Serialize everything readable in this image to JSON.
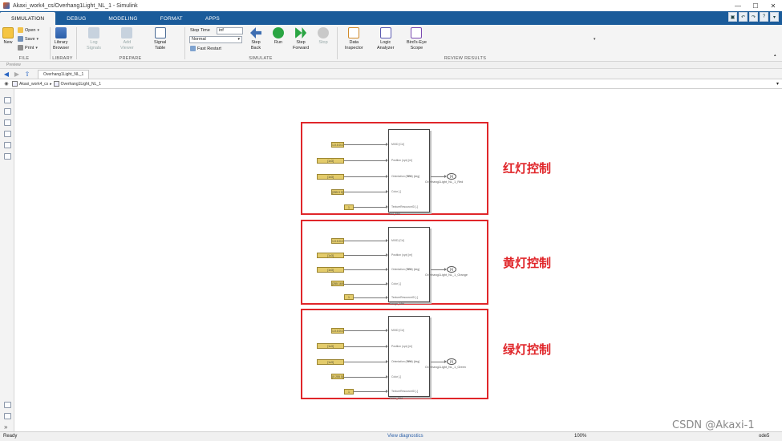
{
  "window": {
    "title": "Akaxi_work4_cs/Overhang1Light_NL_1 - Simulink",
    "controls": [
      "—",
      "☐",
      "✕"
    ]
  },
  "tabs": [
    {
      "label": "SIMULATION",
      "active": true
    },
    {
      "label": "DEBUG"
    },
    {
      "label": "MODELING"
    },
    {
      "label": "FORMAT"
    },
    {
      "label": "APPS"
    }
  ],
  "ribbon": {
    "file": {
      "label": "FILE",
      "new": "New",
      "open": "Open",
      "save": "Save",
      "print": "Print"
    },
    "library": {
      "label": "LIBRARY",
      "browser": "Library\nBrowser"
    },
    "prepare": {
      "label": "PREPARE",
      "log_signals": "Log\nSignals",
      "add_viewer": "Add\nViewer",
      "signal_table": "Signal\nTable"
    },
    "simulate": {
      "label": "SIMULATE",
      "stop_time_label": "Stop Time",
      "stop_time_value": "inf",
      "mode": "Normal",
      "fast_restart": "Fast Restart",
      "step_back": "Step\nBack",
      "run": "Run",
      "step_forward": "Step\nForward",
      "stop": "Stop"
    },
    "review": {
      "label": "REVIEW RESULTS",
      "data_inspector": "Data\nInspector",
      "logic_analyzer": "Logic\nAnalyzer",
      "birds_eye": "Bird's-Eye\nScope"
    }
  },
  "preview_label": "Preview",
  "model_tab": "Overhang1Light_NL_1",
  "breadcrumb": {
    "root": "Akaxi_work4_cs",
    "child": "Overhang1Light_NL_1"
  },
  "diagram": {
    "port_labels": [
      "MXID [Cd]",
      "Position (xyz) [m]",
      "Orientation (RPY) [deg]",
      "Color [-]",
      "TextureResourceID [-]"
    ],
    "blocks": [
      {
        "consts": [
          "1.0.0.0.0.0",
          "[1x3]",
          "[1x3]",
          "[255 0 0]",
          "1"
        ],
        "goto_tag": "[1]",
        "goto_label": "Overhang1Light_NL_1_Red",
        "name": "Red_Mtd",
        "annotation": "红灯控制"
      },
      {
        "consts": [
          "1.0.0.0.0.0",
          "[1x3]",
          "[1x3]",
          "[255 165 0]",
          "1"
        ],
        "goto_tag": "[1]",
        "goto_label": "Overhang1Light_NL_1_Orange",
        "name": "Orange_Mtd",
        "annotation": "黄灯控制"
      },
      {
        "consts": [
          "1.0.0.0.0.0",
          "[1x3]",
          "[1x3]",
          "[0 255 0]",
          "1"
        ],
        "goto_tag": "[1]",
        "goto_label": "Overhang1Light_NL_1_Green",
        "name": "Green_Mtd",
        "annotation": "绿灯控制"
      }
    ]
  },
  "status": {
    "left": "Ready",
    "center": "View diagnostics",
    "zoom": "100%",
    "solver": "ode5"
  },
  "watermark": "CSDN @Akaxi-1",
  "colors": {
    "accent_red": "#e0262a",
    "tab_blue": "#1a5b9a",
    "const_yellow": "#e3cb6b"
  }
}
